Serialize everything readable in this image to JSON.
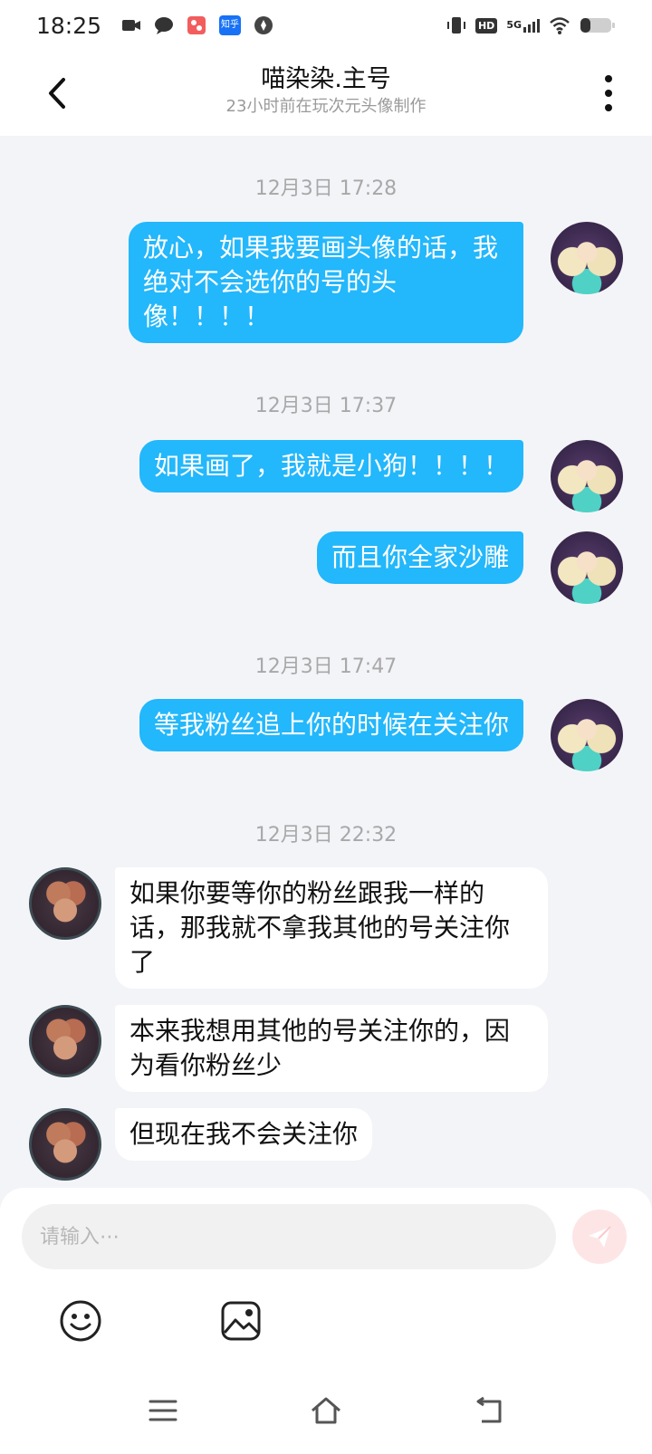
{
  "status_bar": {
    "time": "18:25",
    "notification_icons": [
      "video-icon",
      "chat-icon",
      "app-icon",
      "zhihu-icon",
      "compass-icon"
    ],
    "zhihu_label": "知乎",
    "right_icons": [
      "vibrate-icon",
      "hd-icon",
      "signal-5g-icon",
      "wifi-icon",
      "battery-icon"
    ],
    "hd_label": "HD",
    "network_label": "5G"
  },
  "header": {
    "title": "喵染染.主号",
    "subtitle": "23小时前在玩次元头像制作"
  },
  "messages": [
    {
      "type": "time",
      "text": "12月3日  17:28"
    },
    {
      "type": "out",
      "text": "放心，如果我要画头像的话，我绝对不会选你的号的头像！！！！"
    },
    {
      "type": "time",
      "text": "12月3日  17:37"
    },
    {
      "type": "out",
      "text": "如果画了，我就是小狗！！！！"
    },
    {
      "type": "out",
      "text": "而且你全家沙雕"
    },
    {
      "type": "time",
      "text": "12月3日  17:47"
    },
    {
      "type": "out",
      "text": "等我粉丝追上你的时候在关注你"
    },
    {
      "type": "time",
      "text": "12月3日  22:32"
    },
    {
      "type": "in",
      "text": "如果你要等你的粉丝跟我一样的话，那我就不拿我其他的号关注你了"
    },
    {
      "type": "in",
      "text": "本来我想用其他的号关注你的，因为看你粉丝少"
    },
    {
      "type": "in",
      "text": "但现在我不会关注你"
    }
  ],
  "composer": {
    "placeholder": "请输入⋯",
    "value": ""
  },
  "colors": {
    "outgoing_bubble": "#23b7fb",
    "incoming_bubble": "#ffffff",
    "background": "#f3f4f8",
    "send_button": "#fde5e6"
  }
}
